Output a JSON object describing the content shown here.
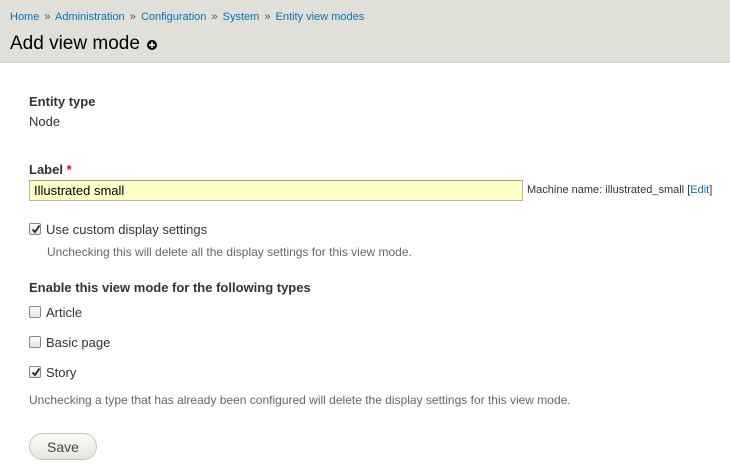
{
  "breadcrumb": {
    "items": [
      "Home",
      "Administration",
      "Configuration",
      "System",
      "Entity view modes"
    ],
    "separator": "»"
  },
  "page": {
    "title": "Add view mode",
    "shortcut_icon": "add-shortcut-icon"
  },
  "entity_type": {
    "label": "Entity type",
    "value": "Node"
  },
  "label_field": {
    "label": "Label",
    "required_mark": "*",
    "value": "Illustrated small",
    "machine_name_prefix": "Machine name: illustrated_small",
    "edit_open": "[",
    "edit_link": "Edit",
    "edit_close": "]"
  },
  "custom_display": {
    "label": "Use custom display settings",
    "checked": true,
    "description": "Unchecking this will delete all the display settings for this view mode."
  },
  "types_section": {
    "title": "Enable this view mode for the following types",
    "types": [
      {
        "label": "Article",
        "checked": false
      },
      {
        "label": "Basic page",
        "checked": false
      },
      {
        "label": "Story",
        "checked": true
      }
    ],
    "description": "Unchecking a type that has already been configured will delete the display settings for this view mode."
  },
  "actions": {
    "save_label": "Save"
  },
  "colors": {
    "link": "#0074bd",
    "header_bg": "#e0e0d8",
    "input_bg": "#ffffc8",
    "required": "#ee0000"
  }
}
